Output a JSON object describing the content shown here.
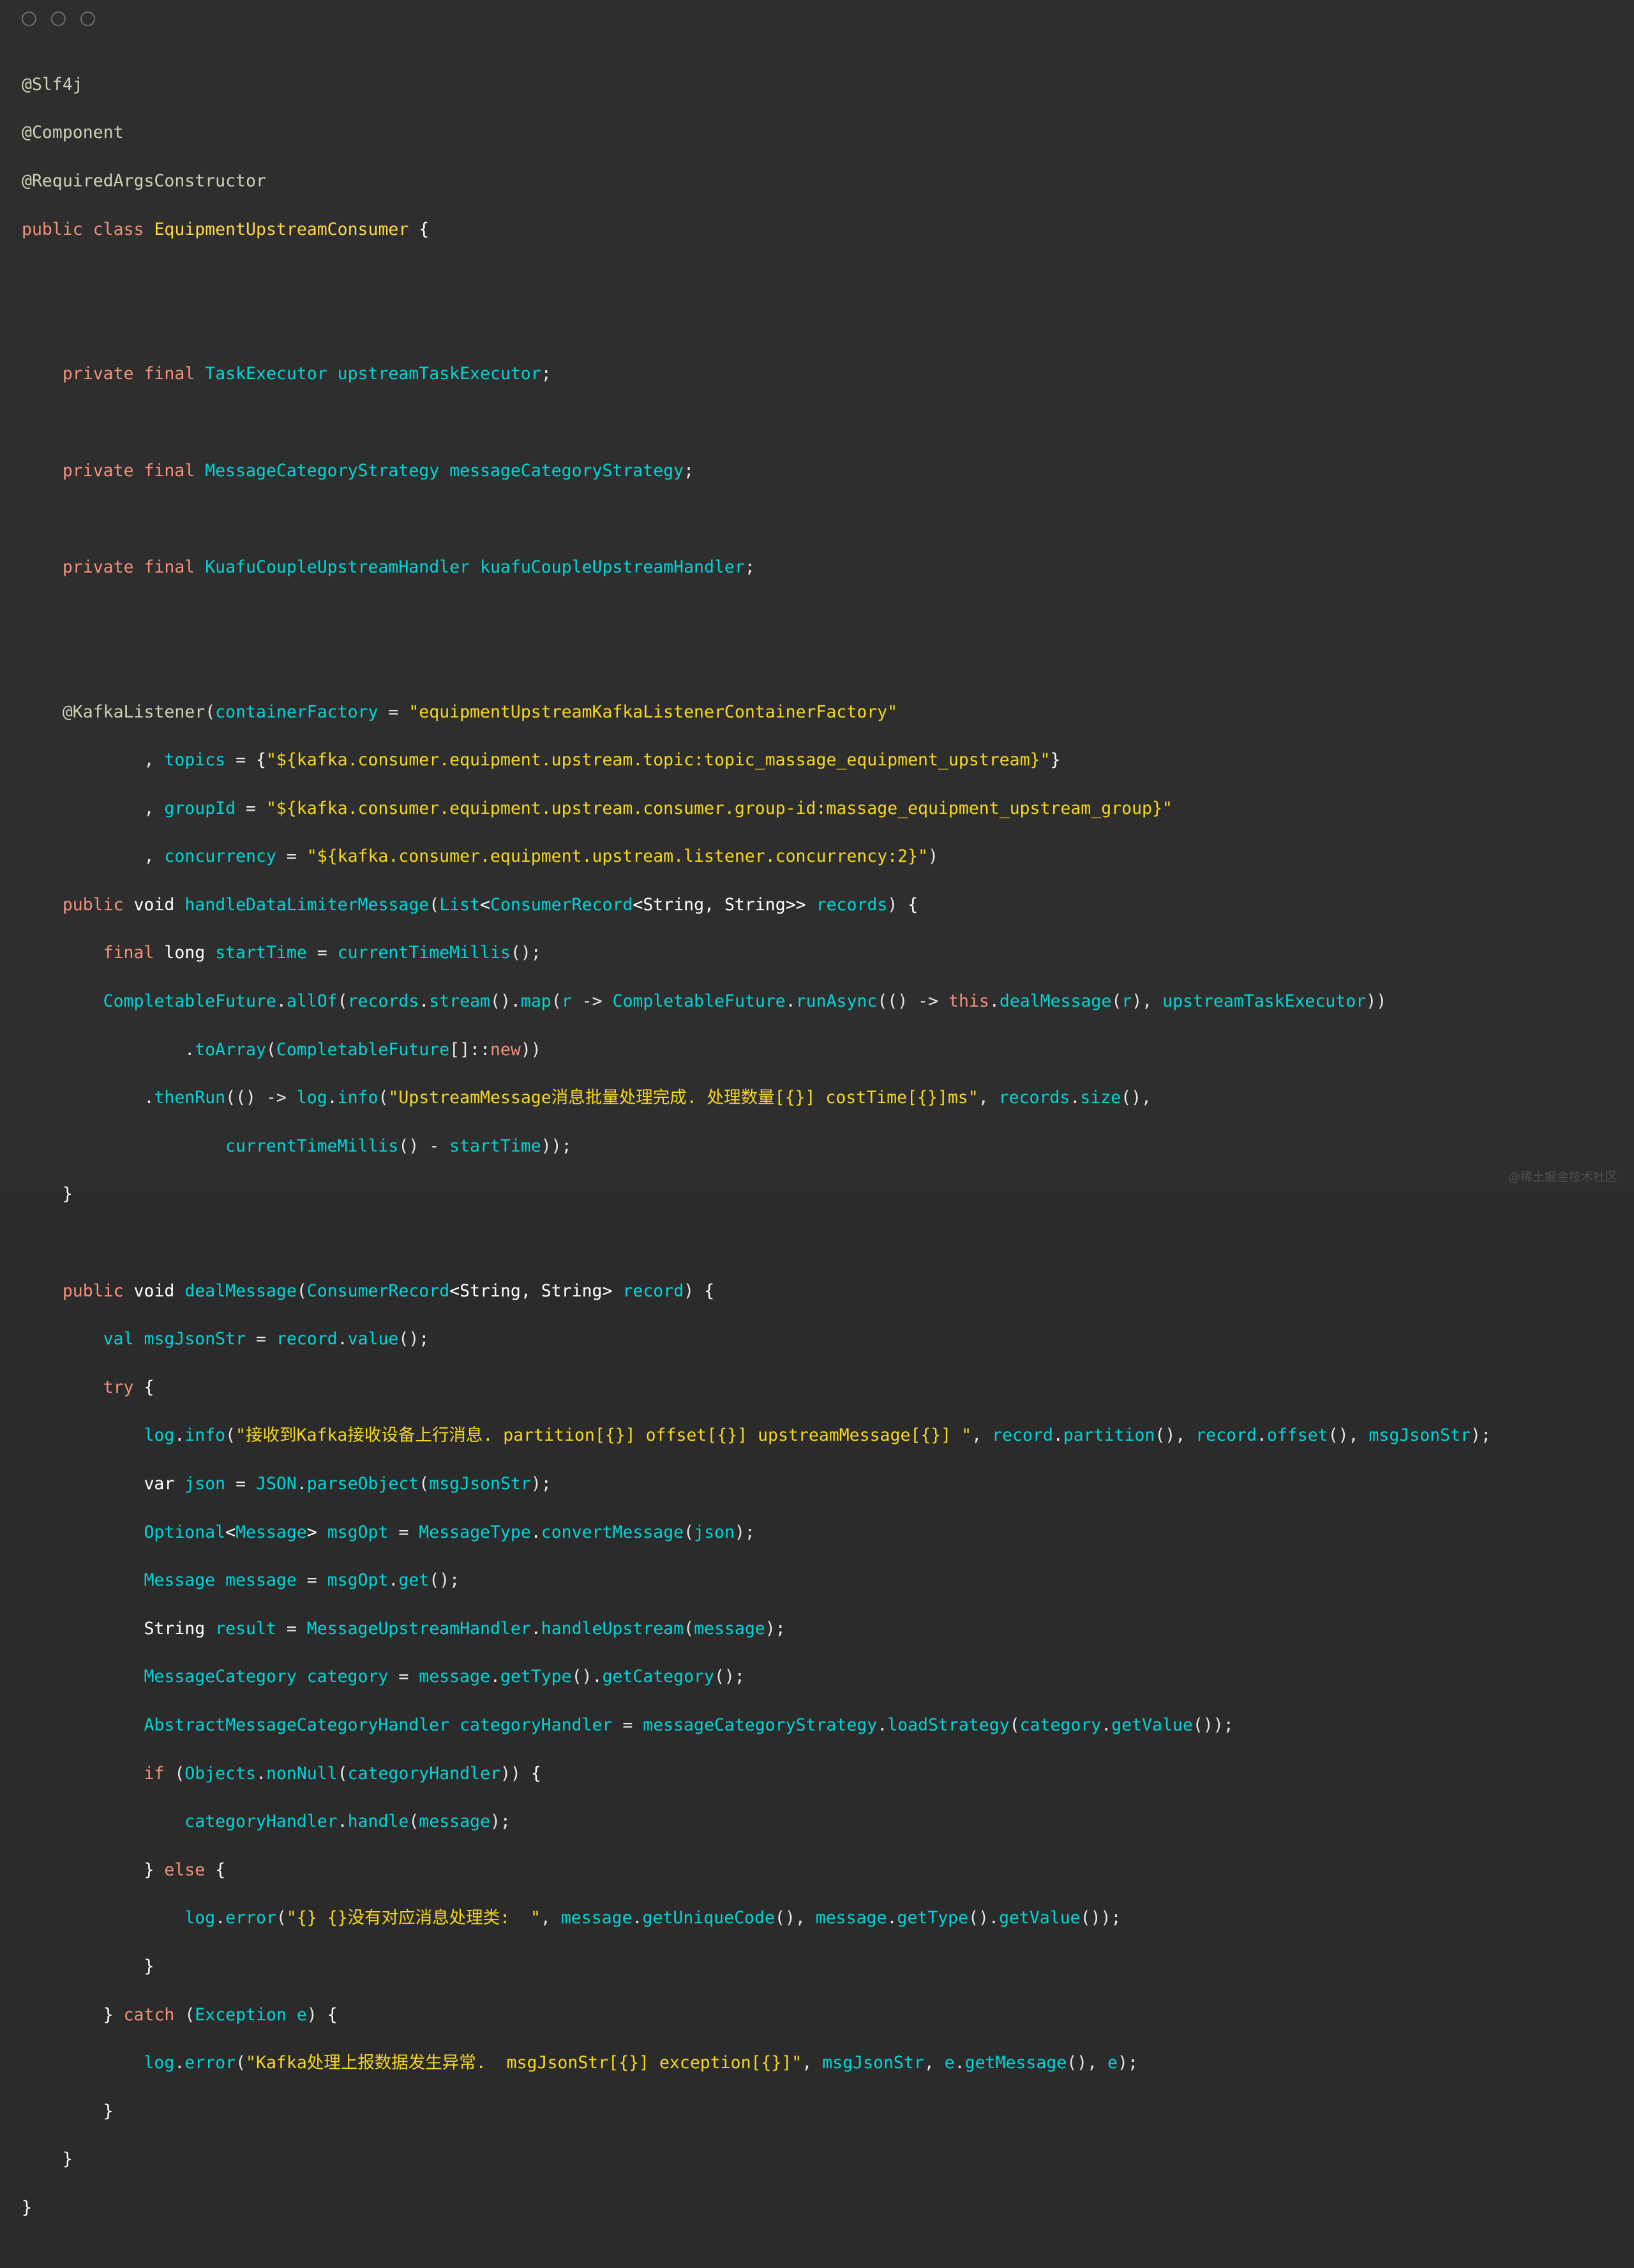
{
  "window": {
    "title": "",
    "traffic_lights": [
      "close-dot",
      "minimize-dot",
      "maximize-dot"
    ],
    "background_color": "#2e2e2e",
    "watermark": "@稀土掘金技术社区"
  },
  "editor": {
    "language": "Java",
    "theme": "dark",
    "font_size_px": 26,
    "colors": {
      "background": "#2e2e2e",
      "keyword": "#f2917b",
      "type": "#00d4d6",
      "class_name": "#ffd943",
      "annotation": "#cfd0b4",
      "string": "#f5d720",
      "plain": "#e6e6e6"
    },
    "lines": [
      "@Slf4j",
      "@Component",
      "@RequiredArgsConstructor",
      "public class EquipmentUpstreamConsumer {",
      "",
      "",
      "    private final TaskExecutor upstreamTaskExecutor;",
      "",
      "    private final MessageCategoryStrategy messageCategoryStrategy;",
      "",
      "    private final KuafuCoupleUpstreamHandler kuafuCoupleUpstreamHandler;",
      "",
      "",
      "    @KafkaListener(containerFactory = \"equipmentUpstreamKafkaListenerContainerFactory\"",
      "            , topics = {\"${kafka.consumer.equipment.upstream.topic:topic_massage_equipment_upstream}\"}",
      "            , groupId = \"${kafka.consumer.equipment.upstream.consumer.group-id:massage_equipment_upstream_group}\"",
      "            , concurrency = \"${kafka.consumer.equipment.upstream.listener.concurrency:2}\")",
      "    public void handleDataLimiterMessage(List<ConsumerRecord<String, String>> records) {",
      "        final long startTime = currentTimeMillis();",
      "        CompletableFuture.allOf(records.stream().map(r -> CompletableFuture.runAsync(() -> this.dealMessage(r), upstreamTaskExecutor))",
      "                .toArray(CompletableFuture[]::new))",
      "            .thenRun(() -> log.info(\"UpstreamMessage消息批量处理完成. 处理数量[{}] costTime[{}]ms\", records.size(),",
      "                    currentTimeMillis() - startTime));",
      "    }",
      "",
      "    public void dealMessage(ConsumerRecord<String, String> record) {",
      "        val msgJsonStr = record.value();",
      "        try {",
      "            log.info(\"接收到Kafka接收设备上行消息. partition[{}] offset[{}] upstreamMessage[{}] \", record.partition(), record.offset(), msgJsonStr);",
      "            var json = JSON.parseObject(msgJsonStr);",
      "            Optional<Message> msgOpt = MessageType.convertMessage(json);",
      "            Message message = msgOpt.get();",
      "            String result = MessageUpstreamHandler.handleUpstream(message);",
      "            MessageCategory category = message.getType().getCategory();",
      "            AbstractMessageCategoryHandler categoryHandler = messageCategoryStrategy.loadStrategy(category.getValue());",
      "            if (Objects.nonNull(categoryHandler)) {",
      "                categoryHandler.handle(message);",
      "            } else {",
      "                log.error(\"{} {}没有对应消息处理类:  \", message.getUniqueCode(), message.getType().getValue());",
      "            }",
      "        } catch (Exception e) {",
      "            log.error(\"Kafka处理上报数据发生异常.  msgJsonStr[{}] exception[{}]\", msgJsonStr, e.getMessage(), e);",
      "        }",
      "    }",
      "}"
    ]
  }
}
